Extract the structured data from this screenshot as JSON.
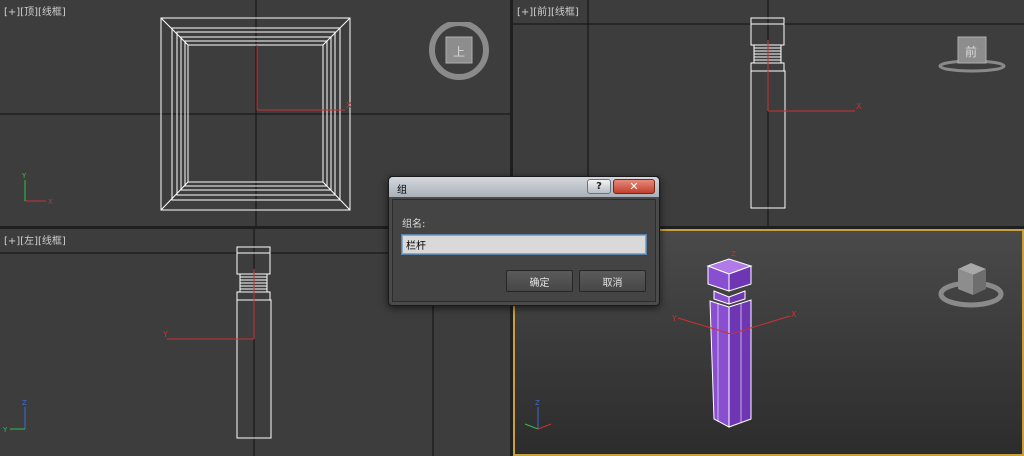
{
  "viewports": {
    "top": {
      "plus": "[+]",
      "view": "[顶]",
      "mode": "[线框]",
      "cube_face": "上"
    },
    "front": {
      "plus": "[+]",
      "view": "[前]",
      "mode": "[线框]",
      "cube_face": "前"
    },
    "left": {
      "plus": "[+]",
      "view": "[左]",
      "mode": "[线框]"
    },
    "persp": {
      "active": true
    }
  },
  "axis_labels": {
    "x": "X",
    "y": "Y",
    "z": "Z"
  },
  "dialog": {
    "title": "组",
    "help": "?",
    "close": "✕",
    "field_label": "组名:",
    "input_value": "栏杆",
    "ok_label": "确定",
    "cancel_label": "取消"
  },
  "colors": {
    "viewport_bg": "#3d3d3d",
    "wire": "#ffffff",
    "active_border": "#c8a03c",
    "object_purple": "#8a4fd0",
    "axis_red": "#c83232",
    "axis_green": "#2fbf4a",
    "axis_blue": "#3a6ad8"
  }
}
